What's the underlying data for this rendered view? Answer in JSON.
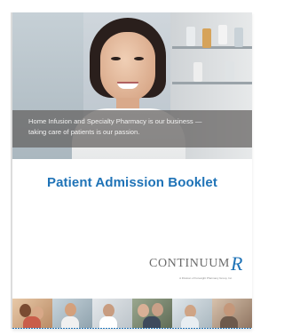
{
  "caption": {
    "line1": "Home Infusion and Specialty Pharmacy is our business —",
    "line2": "taking care of patients is our passion."
  },
  "title": "Patient Admission Booklet",
  "logo": {
    "name": "CONTINUUM",
    "rx": "R",
    "tagline": "A Division of Foresight Pharmacy Group, Inc."
  },
  "colors": {
    "accent": "#1f73b7",
    "caption_band": "#62605e",
    "logo_text": "#6a6a6a"
  }
}
